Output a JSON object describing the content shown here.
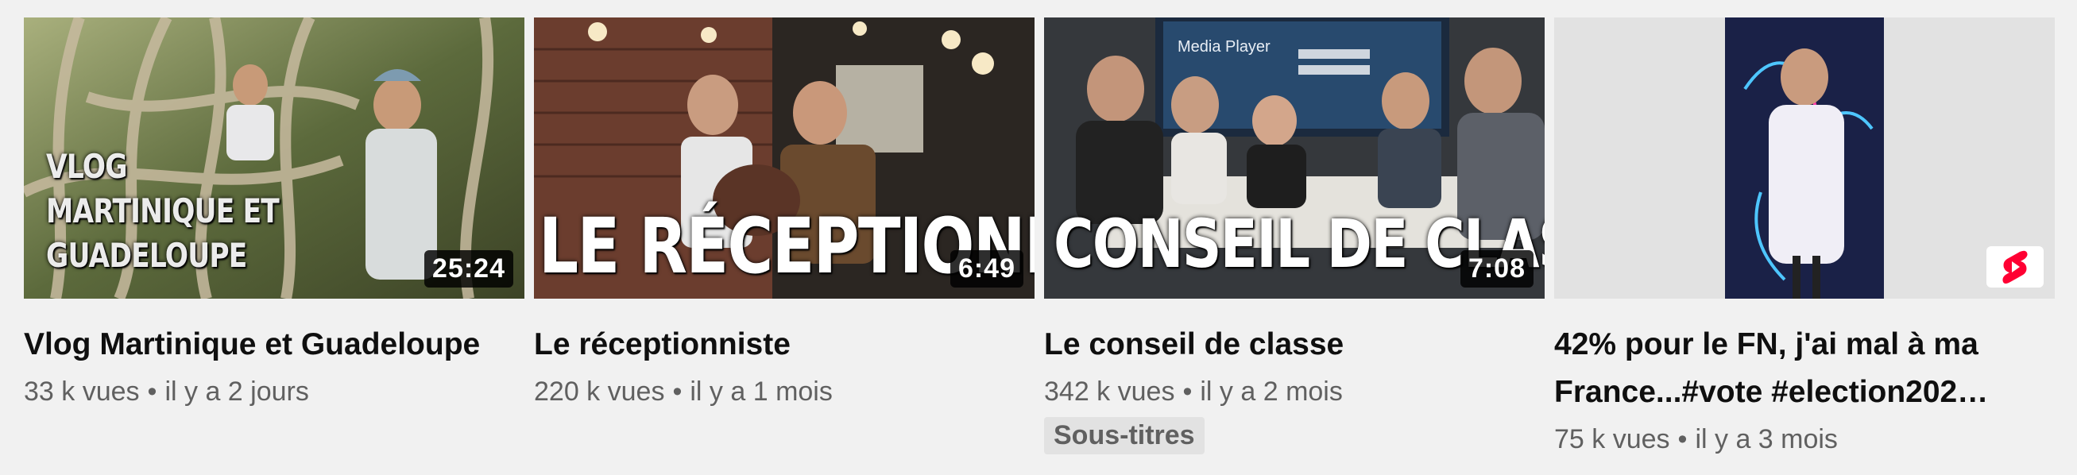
{
  "videos": [
    {
      "thumb_text": "VLOG MARTINIQUE ET GUADELOUPE",
      "duration": "25:24",
      "title": "Vlog Martinique et Guadeloupe",
      "views": "33 k vues",
      "age": "il y a 2 jours"
    },
    {
      "thumb_text": "LE RÉCEPTIONNISTE",
      "duration": "6:49",
      "title": "Le réceptionniste",
      "views": "220 k vues",
      "age": "il y a 1 mois"
    },
    {
      "thumb_text": "CONSEIL DE CLASSE",
      "screen_text": "Media Player",
      "duration": "7:08",
      "title": "Le conseil de classe",
      "views": "342 k vues",
      "age": "il y a 2 mois",
      "badge": "Sous-titres"
    },
    {
      "title_line1": "42% pour le FN, j'ai mal à ma",
      "title_line2": "France...#vote #election202…",
      "views": "75 k vues",
      "age": "il y a 3 mois",
      "shorts_icon": "shorts-icon"
    }
  ],
  "separator": "•",
  "colors": {
    "background": "#f1f1f1",
    "title": "#0f0f0f",
    "meta": "#606060",
    "shorts_red": "#ff0033"
  }
}
